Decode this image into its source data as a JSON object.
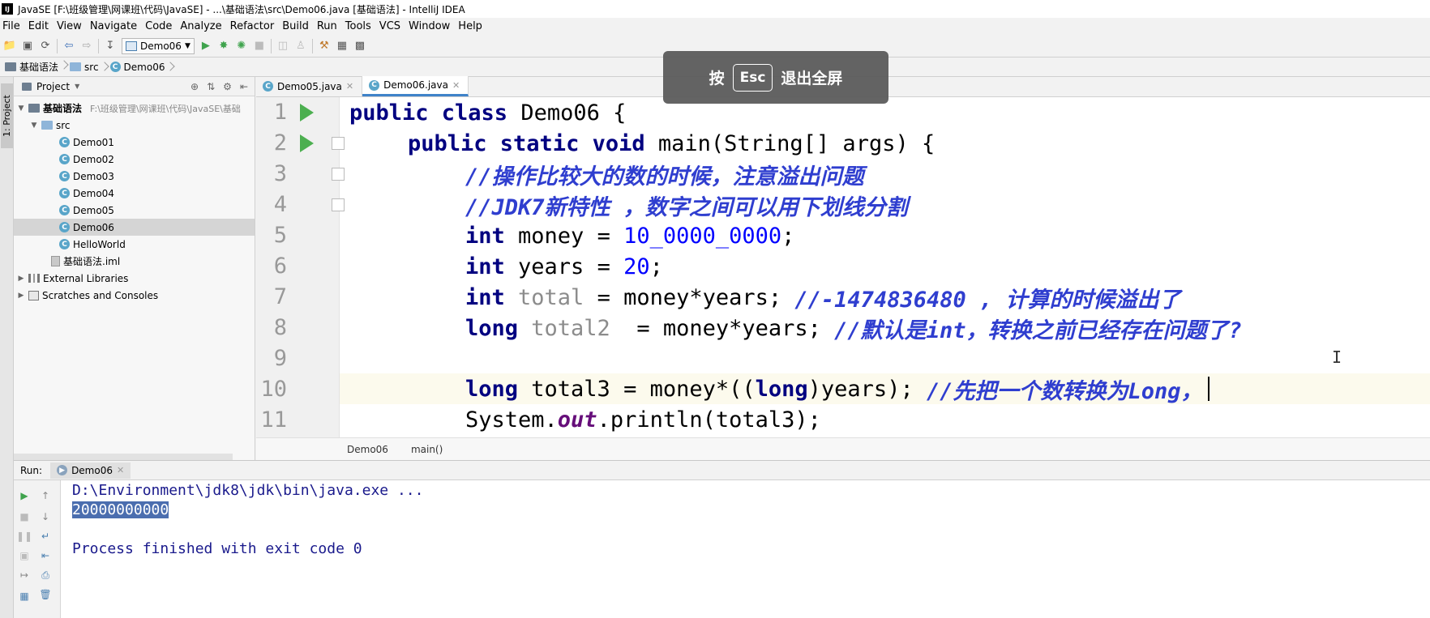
{
  "window": {
    "title": "JavaSE [F:\\班级管理\\网课班\\代码\\JavaSE] - ...\\基础语法\\src\\Demo06.java [基础语法] - IntelliJ IDEA",
    "logo_text": "IJ"
  },
  "menu": [
    "File",
    "Edit",
    "View",
    "Navigate",
    "Code",
    "Analyze",
    "Refactor",
    "Build",
    "Run",
    "Tools",
    "VCS",
    "Window",
    "Help"
  ],
  "toolbar": {
    "run_config": "Demo06"
  },
  "breadcrumb": [
    "基础语法",
    "src",
    "Demo06"
  ],
  "side_strip": {
    "project_tab": "1: Project"
  },
  "project_panel": {
    "title": "Project",
    "tree": [
      {
        "label": "基础语法",
        "hint": "F:\\班级管理\\网课班\\代码\\JavaSE\\基础",
        "type": "module",
        "depth": 0,
        "expanded": true
      },
      {
        "label": "src",
        "hint": "",
        "type": "folder",
        "depth": 1,
        "expanded": true
      },
      {
        "label": "Demo01",
        "hint": "",
        "type": "class",
        "depth": 2
      },
      {
        "label": "Demo02",
        "hint": "",
        "type": "class",
        "depth": 2
      },
      {
        "label": "Demo03",
        "hint": "",
        "type": "class",
        "depth": 2
      },
      {
        "label": "Demo04",
        "hint": "",
        "type": "class",
        "depth": 2
      },
      {
        "label": "Demo05",
        "hint": "",
        "type": "class",
        "depth": 2
      },
      {
        "label": "Demo06",
        "hint": "",
        "type": "class",
        "depth": 2,
        "selected": true
      },
      {
        "label": "HelloWorld",
        "hint": "",
        "type": "class",
        "depth": 2
      },
      {
        "label": "基础语法.iml",
        "hint": "",
        "type": "iml",
        "depth": 1
      },
      {
        "label": "External Libraries",
        "hint": "",
        "type": "lib",
        "depth": 0,
        "expanded": false
      },
      {
        "label": "Scratches and Consoles",
        "hint": "",
        "type": "scratch",
        "depth": 0,
        "expanded": false
      }
    ]
  },
  "editor": {
    "tabs": [
      {
        "label": "Demo05.java",
        "active": false
      },
      {
        "label": "Demo06.java",
        "active": true
      }
    ],
    "line_numbers": [
      "1",
      "2",
      "3",
      "4",
      "5",
      "6",
      "7",
      "8",
      "9",
      "10",
      "11"
    ],
    "current_line": 10,
    "code": {
      "l1_a": "public class ",
      "l1_b": "Demo06 {",
      "l2_a": "public static void ",
      "l2_b": "main(String[] args) {",
      "l3": "//操作比较大的数的时候，注意溢出问题",
      "l4": "//JDK7新特性 ，数字之间可以用下划线分割",
      "l5_kw": "int ",
      "l5_a": "money = ",
      "l5_num": "10_0000_0000",
      "l5_b": ";",
      "l6_kw": "int ",
      "l6_a": "years = ",
      "l6_num": "20",
      "l6_b": ";",
      "l7_kw": "int ",
      "l7_var": "total",
      "l7_a": " = money*years; ",
      "l7_cmt": "//-1474836480 , 计算的时候溢出了",
      "l8_kw": "long ",
      "l8_var": "total2",
      "l8_a": "  = money*years; ",
      "l8_cmt": "//默认是int，转换之前已经存在问题了?",
      "l10_kw": "long ",
      "l10_a": "total3 = money*((",
      "l10_kw2": "long",
      "l10_b": ")years); ",
      "l10_cmt": "//先把一个数转换为Long，",
      "l11_a": "System.",
      "l11_fld": "out",
      "l11_b": ".println(total3);"
    },
    "crumbs": [
      "Demo06",
      "main()"
    ]
  },
  "overlay": {
    "prefix": "按",
    "key": "Esc",
    "suffix": "退出全屏"
  },
  "run_panel": {
    "label": "Run:",
    "tab": "Demo06",
    "console": [
      "D:\\Environment\\jdk8\\jdk\\bin\\java.exe ...",
      "20000000000",
      "",
      "Process finished with exit code 0"
    ]
  },
  "colors": {
    "keyword": "#000080",
    "number": "#0000ff",
    "comment": "#2f3ecf",
    "run_green": "#4caf50",
    "selection": "#4b6eaf"
  }
}
